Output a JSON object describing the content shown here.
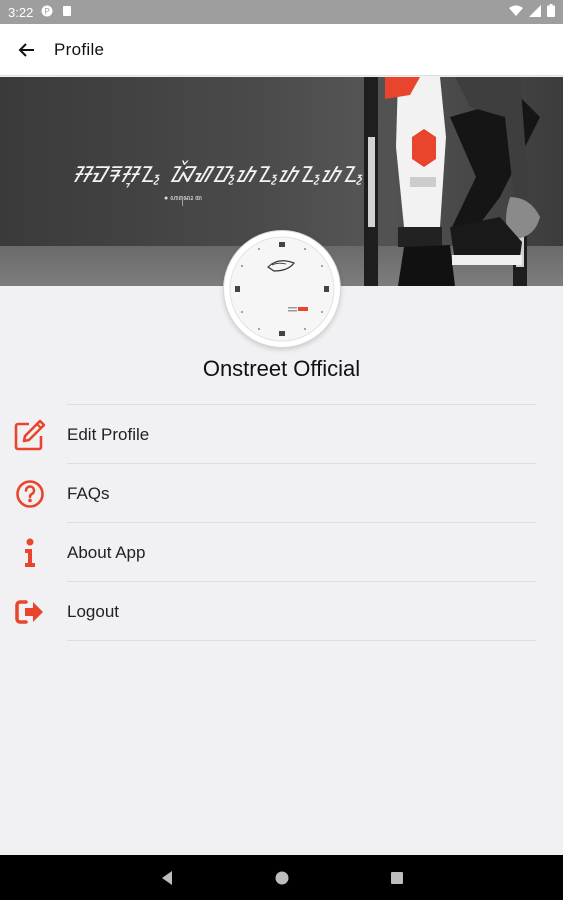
{
  "status_bar": {
    "time": "3:22"
  },
  "app_bar": {
    "title": "Profile"
  },
  "cover": {
    "script_text": "ᮞᮙᮛᮞᮥᮔ᮪ ᮑᮨᮠᮕ᮪ᮒᮔ᮪ᮒᮔ᮪ᮒᮔ᮪!",
    "sub_text": "● ꦲꦤꦺꦴ ꦩ"
  },
  "profile": {
    "name": "Onstreet Official"
  },
  "menu": {
    "items": [
      {
        "label": "Edit Profile",
        "icon": "edit-icon"
      },
      {
        "label": "FAQs",
        "icon": "question-icon"
      },
      {
        "label": "About App",
        "icon": "info-icon"
      },
      {
        "label": "Logout",
        "icon": "logout-icon"
      }
    ]
  },
  "colors": {
    "accent": "#e8452c",
    "background": "#f1f1f4",
    "status_bar": "#9e9e9e"
  }
}
